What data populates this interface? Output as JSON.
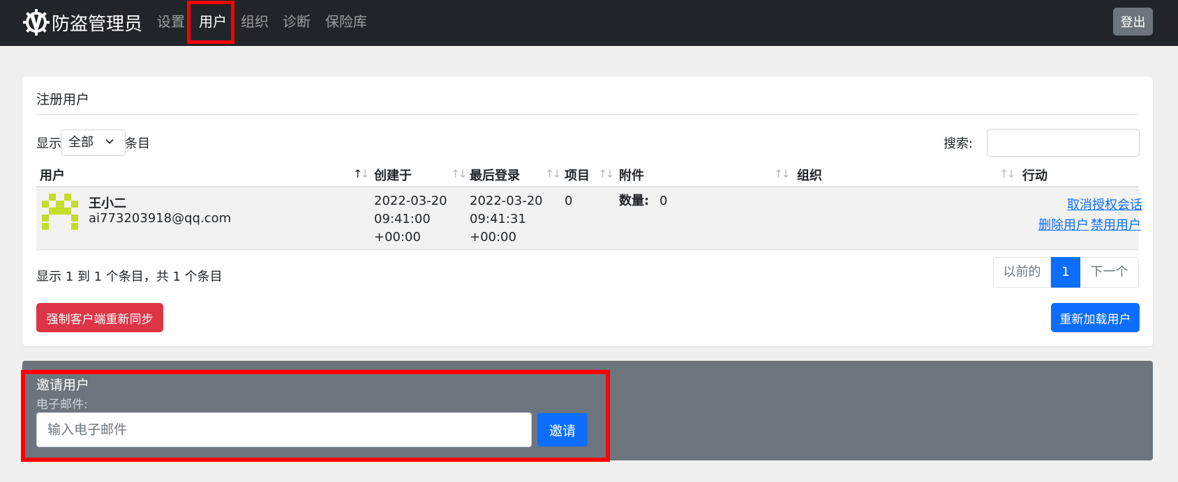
{
  "navbar": {
    "brand": "防盗管理员",
    "items": [
      {
        "label": "设置",
        "active": false
      },
      {
        "label": "用户",
        "active": true
      },
      {
        "label": "组织",
        "active": false
      },
      {
        "label": "诊断",
        "active": false
      },
      {
        "label": "保险库",
        "active": false
      }
    ],
    "logout_label": "登出"
  },
  "users_card": {
    "title": "注册用户",
    "length_prefix": "显示",
    "length_value": "全部",
    "length_suffix": "条目",
    "search_label": "搜索:",
    "search_value": "",
    "columns": [
      "用户",
      "创建于",
      "最后登录",
      "项目",
      "附件",
      "组织",
      "行动"
    ],
    "rows": [
      {
        "name": "王小二",
        "email": "ai773203918@qq.com",
        "created": [
          "2022-03-20",
          "09:41:00",
          "+00:00"
        ],
        "last_login": [
          "2022-03-20",
          "09:41:31",
          "+00:00"
        ],
        "items": "0",
        "attachments_label": "数量:",
        "attachments_count": "0",
        "org": "",
        "actions": {
          "deauth": "取消授权会话",
          "delete": "删除用户",
          "disable": "禁用用户"
        }
      }
    ],
    "info": "显示 1 到 1 个条目，共 1 个条目",
    "pager": {
      "prev": "以前的",
      "current": "1",
      "next": "下一个"
    },
    "force_resync": "强制客户端重新同步",
    "reload_users": "重新加载用户"
  },
  "invite": {
    "title": "邀请用户",
    "email_label": "电子邮件:",
    "email_placeholder": "输入电子邮件",
    "button": "邀请"
  },
  "colors": {
    "navbar": "#212529",
    "primary": "#0d6efd",
    "danger": "#dc3545",
    "secondary": "#6c757d",
    "highlight": "#ff0000",
    "avatar": "#c3dd2a"
  }
}
